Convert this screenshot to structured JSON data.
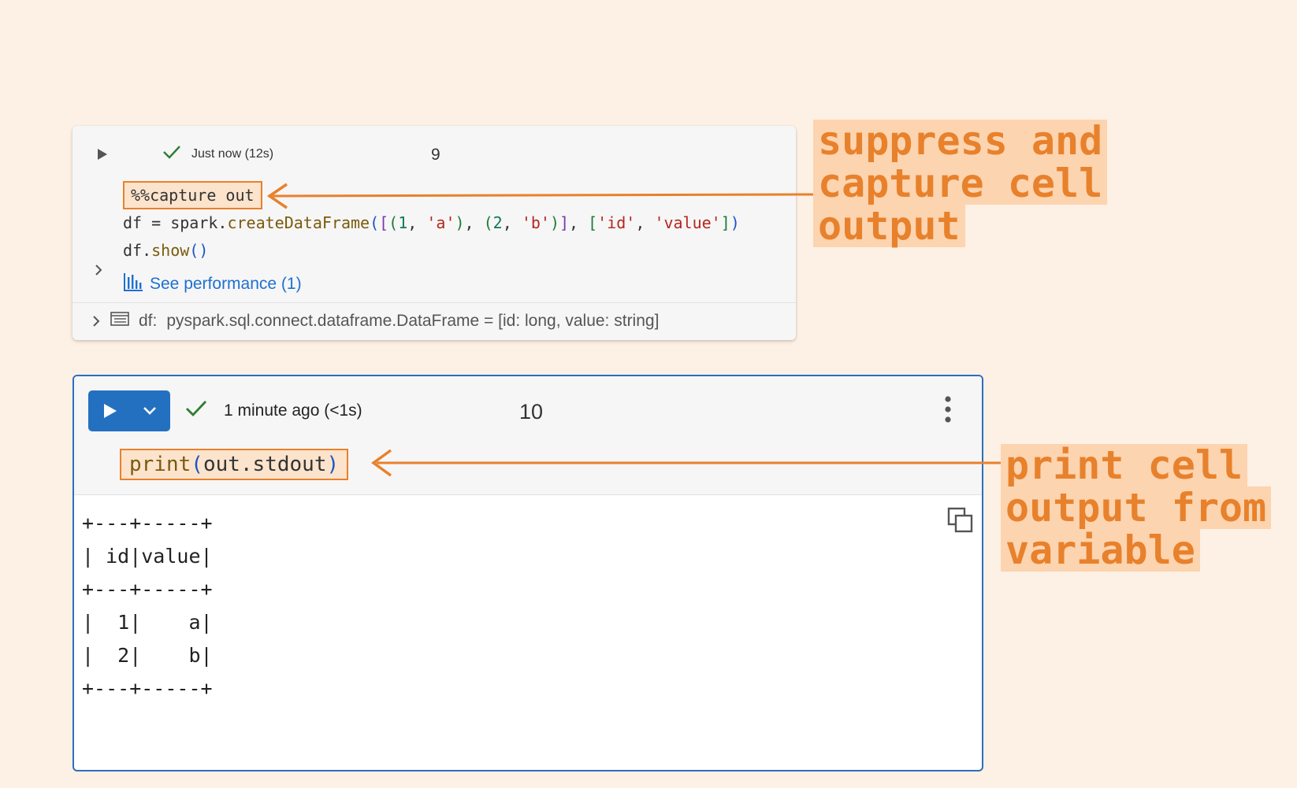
{
  "cell1": {
    "status": "Just now (12s)",
    "cell_number": "9",
    "code": {
      "magic": "%%capture out",
      "line2": {
        "a": "df = spark.",
        "fn": "createDataFrame",
        "p1": "(",
        "p2": "[",
        "p3": "(",
        "n1": "1",
        "c1": ", ",
        "s1": "'a'",
        "p4": ")",
        "c2": ", ",
        "p5": "(",
        "n2": "2",
        "c3": ", ",
        "s2": "'b'",
        "p6": ")",
        "p7": "]",
        "c4": ", ",
        "p8": "[",
        "s3": "'id'",
        "c5": ", ",
        "s4": "'value'",
        "p9": "]",
        "p10": ")"
      },
      "line3": {
        "a": "df.",
        "fn": "show",
        "p": "()"
      }
    },
    "perf_link": "See performance (1)",
    "df_label": "df:",
    "df_type": "pyspark.sql.connect.dataframe.DataFrame = [id: long, value: string]"
  },
  "cell2": {
    "status": "1 minute ago (<1s)",
    "cell_number": "10",
    "code": {
      "fn": "print",
      "open": "(",
      "arg": "out.stdout",
      "close": ")"
    },
    "output_lines": [
      "+---+-----+",
      "| id|value|",
      "+---+-----+",
      "|  1|    a|",
      "|  2|    b|",
      "+---+-----+"
    ]
  },
  "annotations": {
    "first": [
      "suppress and",
      "capture cell",
      "output"
    ],
    "second": [
      "print cell",
      "output from",
      "variable"
    ],
    "color": "#e8812c",
    "highlight": "#fcd4b0"
  },
  "icons": [
    "play-icon",
    "check-icon",
    "chevron-down-icon",
    "chevron-right-icon",
    "bar-chart-icon",
    "table-icon",
    "kebab-menu-icon",
    "copy-icon"
  ],
  "colors": {
    "background": "#fdf0e4",
    "run_button": "#2470c0",
    "active_border": "#2c6fbf",
    "link": "#1f6fd0"
  }
}
